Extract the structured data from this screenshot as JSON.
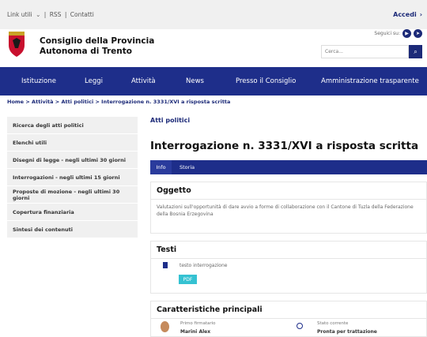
{
  "topbar": {
    "links": [
      "Link utili",
      "RSS",
      "Contatti"
    ],
    "login": "Accedi"
  },
  "header": {
    "brand_line1": "Consiglio della Provincia",
    "brand_line2": "Autonoma di Trento",
    "follow_label": "Seguici su:",
    "search_placeholder": "Cerca..."
  },
  "nav": [
    "Istituzione",
    "Leggi",
    "Attività",
    "News",
    "Presso il Consiglio",
    "Amministrazione trasparente"
  ],
  "breadcrumb": "Home > Attività > Atti politici > Interrogazione n. 3331/XVI a risposta scritta",
  "sidebar": [
    "Ricerca degli atti politici",
    "Elenchi utili",
    "Disegni di legge - negli ultimi 30 giorni",
    "Interrogazioni - negli ultimi 15 giorni",
    "Proposte di mozione - negli ultimi 30 giorni",
    "Copertura finanziaria",
    "Sintesi dei contenuti"
  ],
  "main": {
    "category": "Atti politici",
    "title": "Interrogazione n. 3331/XVI a risposta scritta",
    "tabs": [
      "Info",
      "Storia"
    ],
    "oggetto": {
      "heading": "Oggetto",
      "text": "Valutazioni sull'opportunità di dare avvio a forme di collaborazione con il Cantone di Tuzla della Federazione della Bosnia Erzegovina"
    },
    "testi": {
      "heading": "Testi",
      "doc_name": "testo interrogazione",
      "pdf": "PDF"
    },
    "caratteristiche": {
      "heading": "Caratteristiche principali",
      "firmatario_label": "Primo firmatario",
      "firmatario": "Marini Alex",
      "stato_label": "Stato corrente",
      "stato": "Pronta per trattazione"
    }
  }
}
